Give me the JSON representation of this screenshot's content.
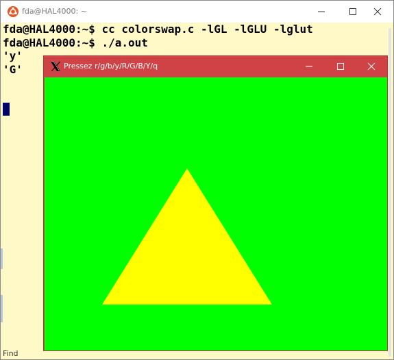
{
  "terminal": {
    "title": "fda@HAL4000: ~",
    "background": "#fff9c8",
    "lines": [
      "fda@HAL4000:~$ cc colorswap.c -lGL -lGLU -lglut",
      "fda@HAL4000:~$ ./a.out",
      "'y'",
      "'G'"
    ],
    "partial_text": "Find",
    "cursor_color": "#000066",
    "icon": "ubuntu-logo-icon"
  },
  "glut_window": {
    "title": "Pressez r/g/b/y/R/G/B/Y/q",
    "titlebar_color": "#cf4346",
    "icon": "x-window-system-icon",
    "canvas": {
      "background_color": "#00ff00",
      "triangle_color": "#ffff00"
    }
  },
  "window_controls": [
    "minimize-icon",
    "maximize-icon",
    "close-icon"
  ]
}
